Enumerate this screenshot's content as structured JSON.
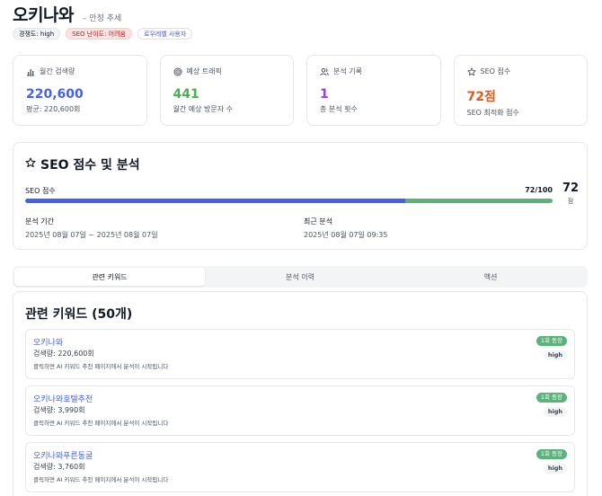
{
  "header": {
    "title": "오키나와",
    "subtitle": "– 안정 추세"
  },
  "badges": [
    {
      "label": "경쟁도: high"
    },
    {
      "label": "SEO 난이도: 어려움"
    },
    {
      "label": "로우레벨 사용자"
    }
  ],
  "stats": [
    {
      "label": "월간 검색량",
      "icon": "bar-chart-icon",
      "value": "220,600",
      "note": "평균: 220,600회",
      "color": "#4361ee"
    },
    {
      "label": "예상 트래픽",
      "icon": "target-icon",
      "value": "441",
      "note": "월간 예상 방문자 수",
      "color": "#4caf50"
    },
    {
      "label": "분석 기록",
      "icon": "users-icon",
      "value": "1",
      "note": "총 분석 횟수",
      "color": "#9c3fe0"
    },
    {
      "label": "SEO 점수",
      "icon": "star-icon",
      "value": "72점",
      "note": "SEO 최적화 점수",
      "color": "#e0591f"
    }
  ],
  "seo": {
    "title": "SEO 점수 및 분석",
    "score_label": "SEO 점수",
    "score_ratio": "72/100",
    "score": "72",
    "score_unit": "점",
    "progress": 0.72,
    "period_label": "분석 기간",
    "period_value": "2025년 08월 07일 ~ 2025년 08월 07일",
    "recent_label": "최근 분석",
    "recent_value": "2025년 08월 07일 09:35"
  },
  "tabs": [
    {
      "label": "관련 키워드",
      "active": true
    },
    {
      "label": "분석 이력",
      "active": false
    },
    {
      "label": "액션",
      "active": false
    }
  ],
  "keywords": {
    "heading": "관련 키워드 (50개)",
    "items": [
      {
        "name": "오키나와",
        "volume": "검색량: 220,600회",
        "hint": "클릭하면 AI 키워드 추천 페이지에서 분석이 시작됩니다",
        "rank": "1회 등장",
        "competition": "high"
      },
      {
        "name": "오키나와호텔추천",
        "volume": "검색량: 3,990회",
        "hint": "클릭하면 AI 키워드 추천 페이지에서 분석이 시작됩니다",
        "rank": "1회 등장",
        "competition": "high"
      },
      {
        "name": "오키나와푸른동굴",
        "volume": "검색량: 3,760회",
        "hint": "클릭하면 AI 키워드 추천 페이지에서 분석이 시작됩니다",
        "rank": "1회 등장",
        "competition": "high"
      }
    ]
  }
}
